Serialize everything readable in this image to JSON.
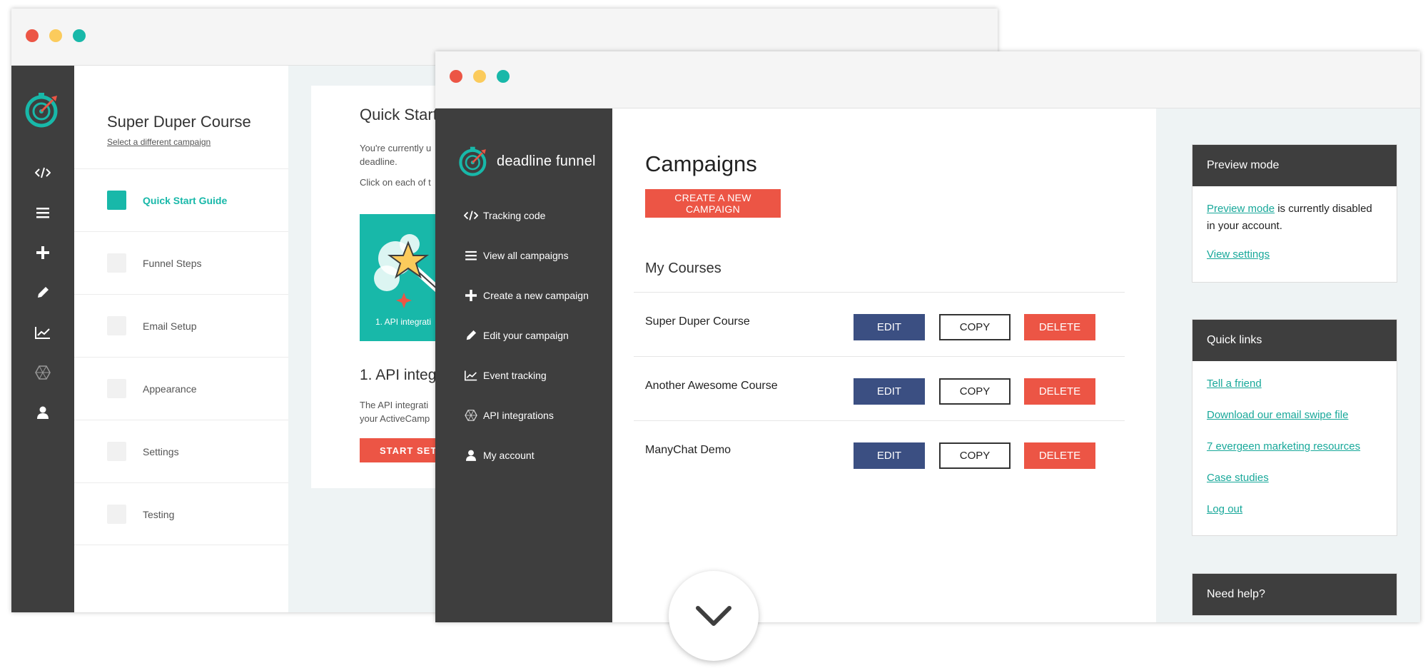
{
  "back_window": {
    "campaign_title": "Super Duper Course",
    "select_link": "Select a different campaign",
    "steps": [
      {
        "label": "Quick Start Guide",
        "active": true
      },
      {
        "label": "Funnel Steps",
        "active": false
      },
      {
        "label": "Email Setup",
        "active": false
      },
      {
        "label": "Appearance",
        "active": false
      },
      {
        "label": "Settings",
        "active": false
      },
      {
        "label": "Testing",
        "active": false
      }
    ],
    "card": {
      "title": "Quick Start",
      "desc1": "You're currently u deadline.",
      "desc2": "Click on each of t",
      "image_caption": "1. API integrati",
      "api_heading": "1. API integ",
      "api_desc_line1": "The API integrati",
      "api_desc_line2": "your ActiveCamp",
      "start_button": "START SETU"
    }
  },
  "front_window": {
    "logo_text": "deadline funnel",
    "nav": [
      {
        "label": "Tracking code",
        "icon": "code-icon"
      },
      {
        "label": "View all campaigns",
        "icon": "list-icon"
      },
      {
        "label": "Create a new campaign",
        "icon": "plus-icon"
      },
      {
        "label": "Edit your campaign",
        "icon": "pencil-icon"
      },
      {
        "label": "Event tracking",
        "icon": "chart-icon"
      },
      {
        "label": "API integrations",
        "icon": "hexagon-icon"
      },
      {
        "label": "My account",
        "icon": "user-icon"
      }
    ],
    "page_title": "Campaigns",
    "create_button": "CREATE A NEW CAMPAIGN",
    "section_title": "My Courses",
    "courses": [
      {
        "name": "Super Duper Course"
      },
      {
        "name": "Another Awesome Course"
      },
      {
        "name": "ManyChat Demo"
      }
    ],
    "edit_label": "EDIT",
    "copy_label": "COPY",
    "delete_label": "DELETE",
    "preview_panel": {
      "title": "Preview mode",
      "link_text": "Preview mode",
      "text": " is currently disabled in your account.",
      "settings_link": "View settings"
    },
    "quick_links_panel": {
      "title": "Quick links",
      "links": [
        "Tell a friend",
        "Download our email swipe file",
        "7 evergeen marketing resources",
        "Case studies",
        "Log out"
      ]
    },
    "help_panel": {
      "title": "Need help?"
    }
  },
  "colors": {
    "accent_teal": "#18b8a9",
    "danger_red": "#ec5545",
    "edit_blue": "#3b4f82",
    "sidebar_dark": "#3e3e3e"
  }
}
